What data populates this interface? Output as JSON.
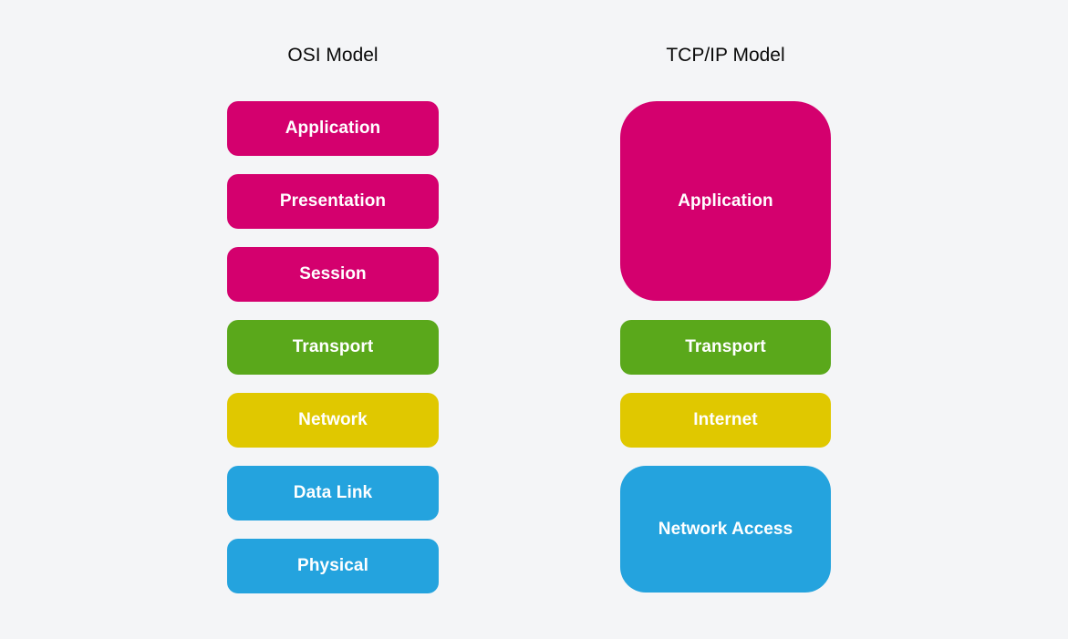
{
  "diagram": {
    "background_color": "#f4f5f7",
    "columns": [
      {
        "id": "osi",
        "title": "OSI Model",
        "layers": [
          {
            "label": "Application",
            "color": "#d4006e",
            "span": 1
          },
          {
            "label": "Presentation",
            "color": "#d4006e",
            "span": 1
          },
          {
            "label": "Session",
            "color": "#d4006e",
            "span": 1
          },
          {
            "label": "Transport",
            "color": "#5aa81b",
            "span": 1
          },
          {
            "label": "Network",
            "color": "#e0c800",
            "span": 1
          },
          {
            "label": "Data Link",
            "color": "#24a3de",
            "span": 1
          },
          {
            "label": "Physical",
            "color": "#24a3de",
            "span": 1
          }
        ]
      },
      {
        "id": "tcpip",
        "title": "TCP/IP Model",
        "layers": [
          {
            "label": "Application",
            "color": "#d4006e",
            "span": 3
          },
          {
            "label": "Transport",
            "color": "#5aa81b",
            "span": 1
          },
          {
            "label": "Internet",
            "color": "#e0c800",
            "span": 1
          },
          {
            "label": "Network Access",
            "color": "#24a3de",
            "span": 2
          }
        ]
      }
    ]
  }
}
